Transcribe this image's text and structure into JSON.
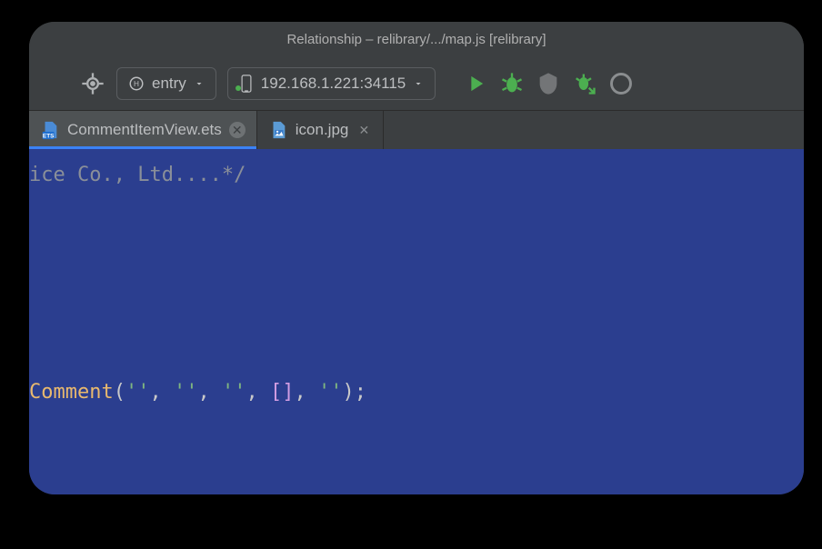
{
  "window": {
    "title": "Relationship – relibrary/.../map.js [relibrary]"
  },
  "toolbar": {
    "config_label": "entry",
    "device_label": "192.168.1.221:34115"
  },
  "tabs": [
    {
      "label": "CommentItemView.ets",
      "active": true
    },
    {
      "label": "icon.jpg",
      "active": false
    }
  ],
  "editor": {
    "lines": [
      {
        "type": "comment",
        "text": "ice Co., Ltd....*/"
      },
      {
        "type": "blank",
        "text": ""
      },
      {
        "type": "blank",
        "text": ""
      },
      {
        "type": "blank",
        "text": ""
      },
      {
        "type": "blank",
        "text": ""
      },
      {
        "type": "blank",
        "text": ""
      },
      {
        "type": "blank",
        "text": ""
      },
      {
        "type": "code",
        "segments": [
          {
            "cls": "tok-fn",
            "text": "Comment"
          },
          {
            "cls": "tok-punct",
            "text": "("
          },
          {
            "cls": "tok-str",
            "text": "''"
          },
          {
            "cls": "tok-punct",
            "text": ", "
          },
          {
            "cls": "tok-str",
            "text": "''"
          },
          {
            "cls": "tok-punct",
            "text": ", "
          },
          {
            "cls": "tok-str",
            "text": "''"
          },
          {
            "cls": "tok-punct",
            "text": ", "
          },
          {
            "cls": "tok-brack",
            "text": "[]"
          },
          {
            "cls": "tok-punct",
            "text": ", "
          },
          {
            "cls": "tok-str",
            "text": "''"
          },
          {
            "cls": "tok-punct",
            "text": ");"
          }
        ]
      }
    ]
  }
}
